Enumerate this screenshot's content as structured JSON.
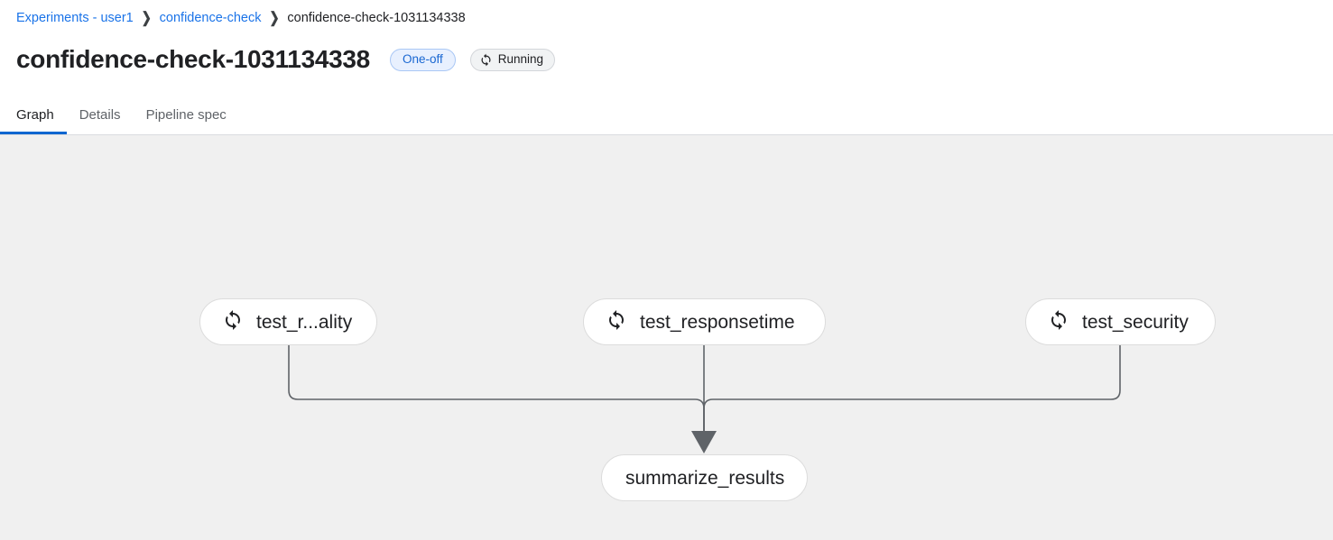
{
  "breadcrumb": {
    "items": [
      {
        "label": "Experiments - user1",
        "type": "link"
      },
      {
        "label": "confidence-check",
        "type": "link"
      },
      {
        "label": "confidence-check-1031134338",
        "type": "current"
      }
    ],
    "separator": "❯"
  },
  "header": {
    "title": "confidence-check-1031134338",
    "type_badge": "One-off",
    "status_badge": "Running",
    "status_icon": "sync-icon",
    "type_badge_bg": "#e8f0fe",
    "type_badge_text": "#1967d2",
    "status_badge_bg": "#f1f3f4"
  },
  "tabs": {
    "items": [
      {
        "label": "Graph",
        "active": true
      },
      {
        "label": "Details",
        "active": false
      },
      {
        "label": "Pipeline spec",
        "active": false
      }
    ],
    "active_underline_color": "#0b66d0"
  },
  "graph": {
    "background": "#f0f0f0",
    "edge_color": "#5f6368",
    "node_fill": "#ffffff",
    "node_border": "#dcdcdc",
    "nodes": [
      {
        "id": "test_reliability",
        "label": "test_r...ality",
        "icon": "sync-icon",
        "has_icon": true
      },
      {
        "id": "test_responsetime",
        "label": "test_responsetime",
        "icon": "sync-icon",
        "has_icon": true
      },
      {
        "id": "test_security",
        "label": "test_security",
        "icon": "sync-icon",
        "has_icon": true
      },
      {
        "id": "summarize_results",
        "label": "summarize_results",
        "icon": null,
        "has_icon": false
      }
    ],
    "edges": [
      {
        "from": "test_reliability",
        "to": "summarize_results"
      },
      {
        "from": "test_responsetime",
        "to": "summarize_results"
      },
      {
        "from": "test_security",
        "to": "summarize_results"
      }
    ]
  }
}
